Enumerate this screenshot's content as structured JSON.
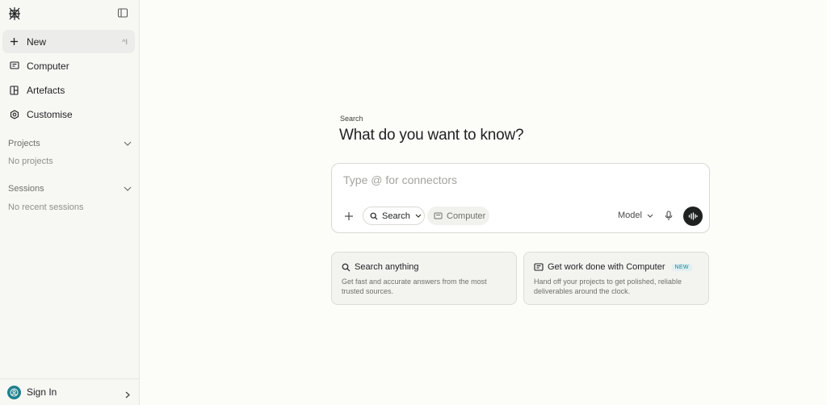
{
  "sidebar": {
    "nav": [
      {
        "label": "New",
        "icon": "plus-icon",
        "shortcut": "^I"
      },
      {
        "label": "Computer",
        "icon": "computer-icon"
      },
      {
        "label": "Artefacts",
        "icon": "artefacts-icon"
      },
      {
        "label": "Customise",
        "icon": "customise-icon"
      }
    ],
    "projects": {
      "title": "Projects",
      "empty": "No projects"
    },
    "sessions": {
      "title": "Sessions",
      "empty": "No recent sessions"
    },
    "signin": "Sign In"
  },
  "main": {
    "eyebrow": "Search",
    "headline": "What do you want to know?",
    "composer": {
      "placeholder": "Type @ for connectors",
      "search_label": "Search",
      "computer_label": "Computer",
      "model_label": "Model"
    },
    "cards": [
      {
        "title": "Search anything",
        "desc": "Get fast and accurate answers from the most trusted sources.",
        "icon": "search-icon"
      },
      {
        "title": "Get work done with Computer",
        "badge": "NEW",
        "desc": "Hand off your projects to get polished, reliable deliverables around the clock.",
        "icon": "computer-icon"
      }
    ]
  },
  "colors": {
    "accent": "#20808d",
    "background": "#fcfcf9",
    "sidebar": "#f7f7f4",
    "text": "#1f2121"
  }
}
